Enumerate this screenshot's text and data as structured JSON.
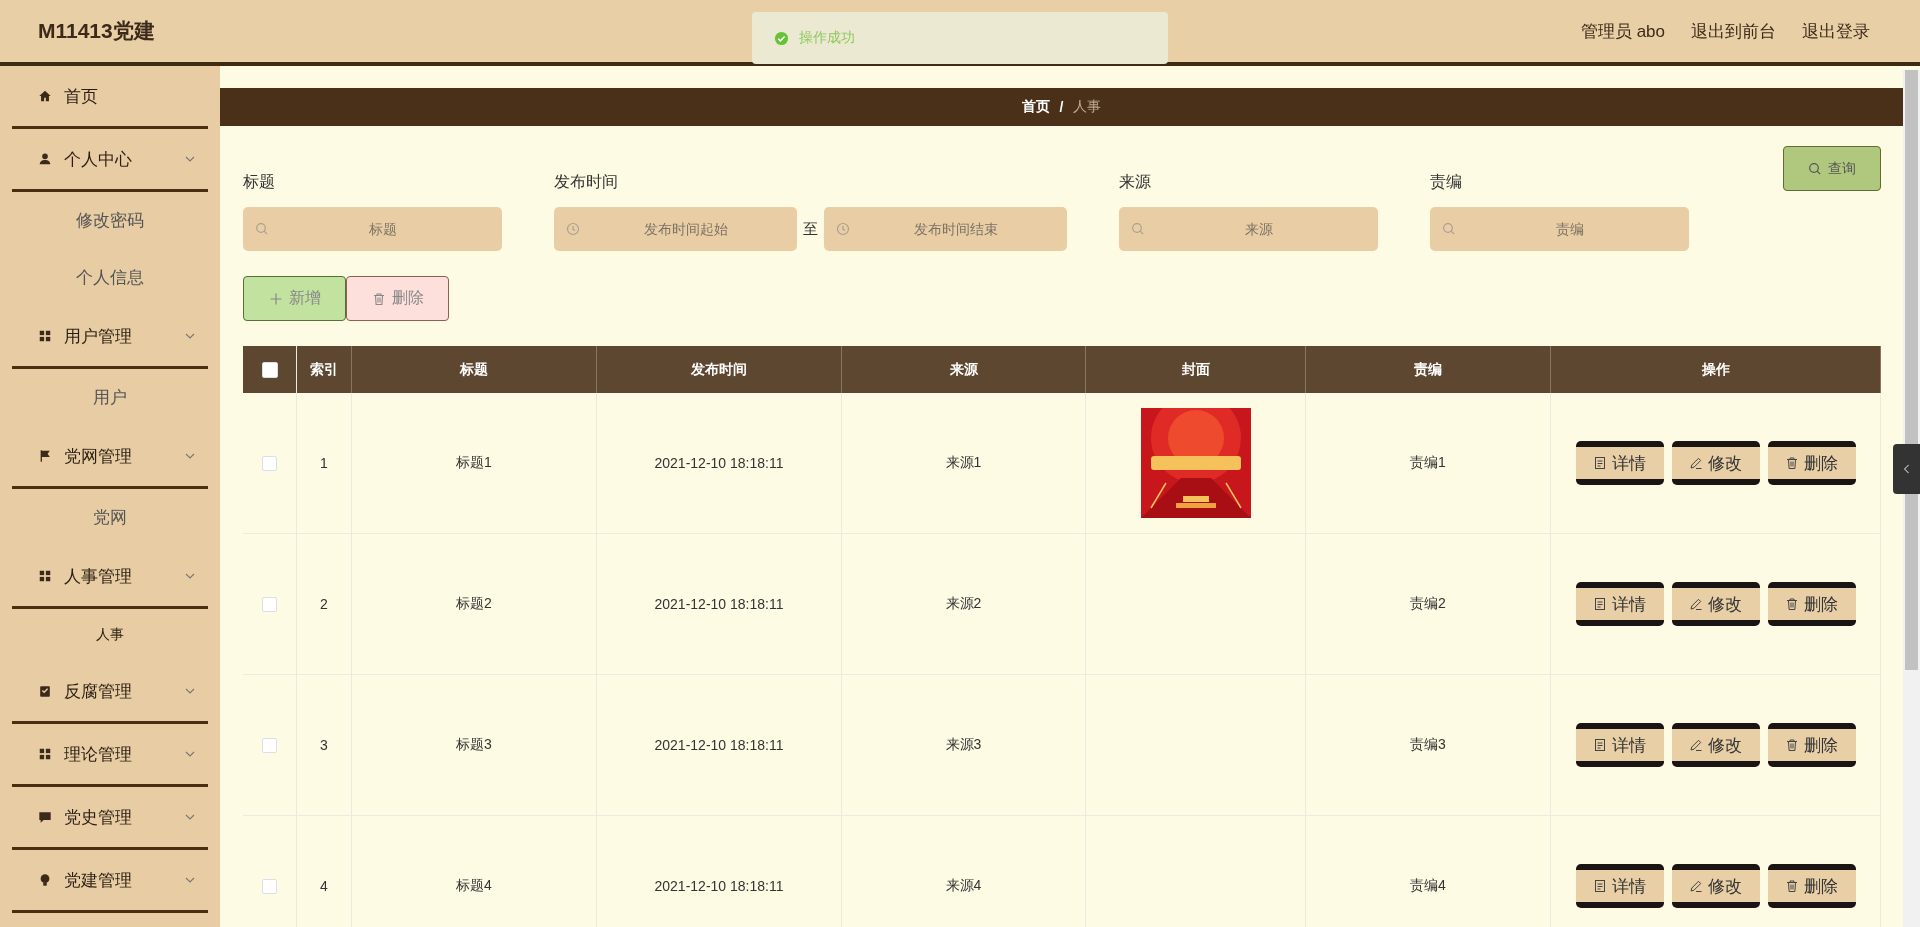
{
  "brand": "M11413党建",
  "toast": {
    "text": "操作成功"
  },
  "user_menu": [
    "管理员 abo",
    "退出到前台",
    "退出登录"
  ],
  "sidebar": {
    "items": [
      {
        "label": "首页",
        "kind": "link"
      },
      {
        "label": "个人中心",
        "kind": "submenu",
        "children": [
          {
            "label": "修改密码",
            "selected": false
          },
          {
            "label": "个人信息",
            "selected": false
          }
        ]
      },
      {
        "label": "用户管理",
        "kind": "submenu",
        "children": [
          {
            "label": "用户",
            "selected": false
          }
        ]
      },
      {
        "label": "党网管理",
        "kind": "submenu",
        "children": [
          {
            "label": "党网",
            "selected": false
          }
        ]
      },
      {
        "label": "人事管理",
        "kind": "submenu",
        "children": [
          {
            "label": "人事",
            "selected": true
          }
        ]
      },
      {
        "label": "反腐管理",
        "kind": "submenu"
      },
      {
        "label": "理论管理",
        "kind": "submenu"
      },
      {
        "label": "党史管理",
        "kind": "submenu"
      },
      {
        "label": "党建管理",
        "kind": "submenu"
      }
    ]
  },
  "breadcrumb": {
    "items": [
      "首页",
      "人事"
    ],
    "separator": "/"
  },
  "filters": [
    {
      "kind": "text",
      "label": "标题",
      "placeholder": "标题"
    },
    {
      "kind": "daterange",
      "label": "发布时间",
      "placeholder": "发布时间起始",
      "separator": "至",
      "placeholder_end": "发布时间结束"
    },
    {
      "kind": "text",
      "label": "来源",
      "placeholder": "来源"
    },
    {
      "kind": "text",
      "label": "责编",
      "placeholder": "责编"
    }
  ],
  "search_button": "查询",
  "actions": [
    {
      "kind": "add",
      "label": "新增"
    },
    {
      "kind": "delete",
      "label": "删除"
    }
  ],
  "table": {
    "all_checked": false,
    "columns": [
      "索引",
      "标题",
      "发布时间",
      "来源",
      "封面",
      "责编",
      "操作"
    ],
    "rows": [
      {
        "checked": false,
        "index": "1",
        "title": "标题1",
        "time": "2021-12-10 18:18:11",
        "source": "来源1",
        "cover": {
          "kind": "picture"
        },
        "editor": "责编1",
        "buttons": [
          {
            "kind": "detail",
            "label": "详情"
          },
          {
            "kind": "edit",
            "label": "修改"
          },
          {
            "kind": "delete",
            "label": "删除"
          }
        ]
      },
      {
        "checked": false,
        "index": "2",
        "title": "标题2",
        "time": "2021-12-10 18:18:11",
        "source": "来源2",
        "editor": "责编2",
        "buttons": [
          {
            "kind": "detail",
            "label": "详情"
          },
          {
            "kind": "edit",
            "label": "修改"
          },
          {
            "kind": "delete",
            "label": "删除"
          }
        ]
      },
      {
        "checked": false,
        "index": "3",
        "title": "标题3",
        "time": "2021-12-10 18:18:11",
        "source": "来源3",
        "editor": "责编3",
        "buttons": [
          {
            "kind": "detail",
            "label": "详情"
          },
          {
            "kind": "edit",
            "label": "修改"
          },
          {
            "kind": "delete",
            "label": "删除"
          }
        ]
      },
      {
        "checked": false,
        "index": "4",
        "title": "标题4",
        "time": "2021-12-10 18:18:11",
        "source": "来源4",
        "editor": "责编4",
        "buttons": [
          {
            "kind": "detail",
            "label": "详情"
          },
          {
            "kind": "edit",
            "label": "修改"
          },
          {
            "kind": "delete",
            "label": "删除"
          }
        ]
      }
    ]
  }
}
